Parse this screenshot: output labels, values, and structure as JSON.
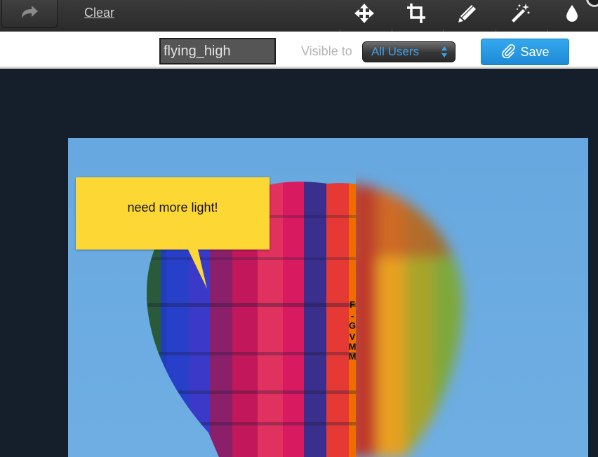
{
  "toolbar": {
    "clear_label": "Clear",
    "tools": [
      "move-icon",
      "crop-icon",
      "pencil-icon",
      "magic-wand-icon",
      "droplet-icon"
    ]
  },
  "editor_bar": {
    "title_value": "flying_high",
    "visible_to_label": "Visible to",
    "visibility_selected": "All Users",
    "save_label": "Save"
  },
  "annotation": {
    "text": "need more light!"
  },
  "photo": {
    "registration_text": "F-GVMM"
  },
  "colors": {
    "accent_blue": "#2496e4",
    "note_yellow": "#fdd835",
    "canvas_bg": "#141f2b",
    "sky": "#6aaae2"
  }
}
